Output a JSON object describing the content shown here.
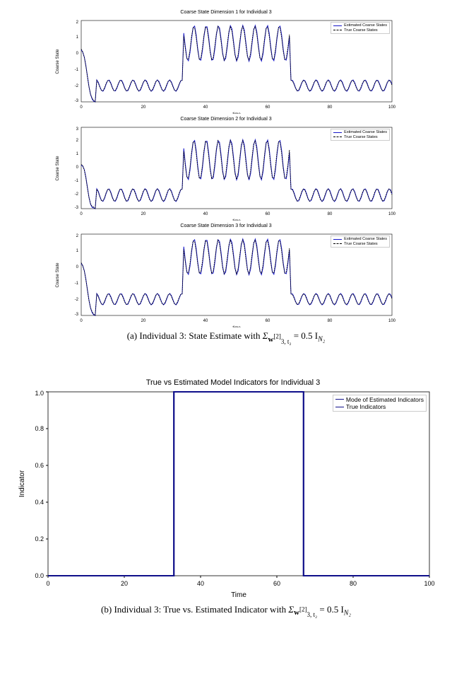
{
  "chart_data": [
    {
      "type": "line",
      "title": "Coarse State Dimension 1 for Individual 3",
      "xlabel": "time",
      "ylabel": "Coarse State",
      "xlim": [
        0,
        100
      ],
      "ylim": [
        -3,
        2
      ],
      "legend": [
        "Estimated Coarse States",
        "True Coarse States"
      ],
      "series_note": "Two overlapping oscillatory traces (blue solid + black dashed) with step regime shift between t≈33 and t≈67; values oscillate around -2 outside and around 0.5–1.5 inside the central window."
    },
    {
      "type": "line",
      "title": "Coarse State Dimension 2 for Individual 3",
      "xlabel": "time",
      "ylabel": "Coarse State",
      "xlim": [
        0,
        100
      ],
      "ylim": [
        -3,
        3
      ],
      "legend": [
        "Estimated Coarse States",
        "True Coarse States"
      ],
      "series_note": "Same structure as panel 1 with slightly larger amplitude; peaks near 3 in central window."
    },
    {
      "type": "line",
      "title": "Coarse State Dimension 3 for Individual 3",
      "xlabel": "time",
      "ylabel": "Coarse State",
      "xlim": [
        0,
        100
      ],
      "ylim": [
        -3,
        2
      ],
      "legend": [
        "Estimated Coarse States",
        "True Coarse States"
      ],
      "series_note": "Same structure as panels 1–2; overlapping estimated vs true."
    },
    {
      "type": "line",
      "title": "True vs Estimated Model Indicators for Individual 3",
      "xlabel": "Time",
      "ylabel": "Indicator",
      "xlim": [
        0,
        100
      ],
      "ylim": [
        0.0,
        1.0
      ],
      "yticks": [
        0.0,
        0.2,
        0.4,
        0.6,
        0.8,
        1.0
      ],
      "xticks": [
        0,
        20,
        40,
        60,
        80,
        100
      ],
      "legend": [
        "Mode of Estimated Indicators",
        "True Indicators"
      ],
      "series": [
        {
          "name": "Mode of Estimated Indicators",
          "x": [
            0,
            33,
            33,
            67,
            67,
            100
          ],
          "y": [
            0,
            0,
            1,
            1,
            0,
            0
          ]
        },
        {
          "name": "True Indicators",
          "x": [
            0,
            33,
            33,
            67,
            67,
            100
          ],
          "y": [
            0,
            0,
            1,
            1,
            0,
            0
          ]
        }
      ]
    }
  ],
  "captions": {
    "a_prefix": "(a) Individual 3: State Estimate with ",
    "b_prefix": "(b) Individual 3: True vs. Estimated Indicator with ",
    "sigma_expr": "Σ",
    "sigma_sub": "w",
    "sigma_sup": "[2]",
    "sigma_sub2": "3, t₂",
    "eq_rhs": " = 0.5 I",
    "N2": "N₂"
  }
}
